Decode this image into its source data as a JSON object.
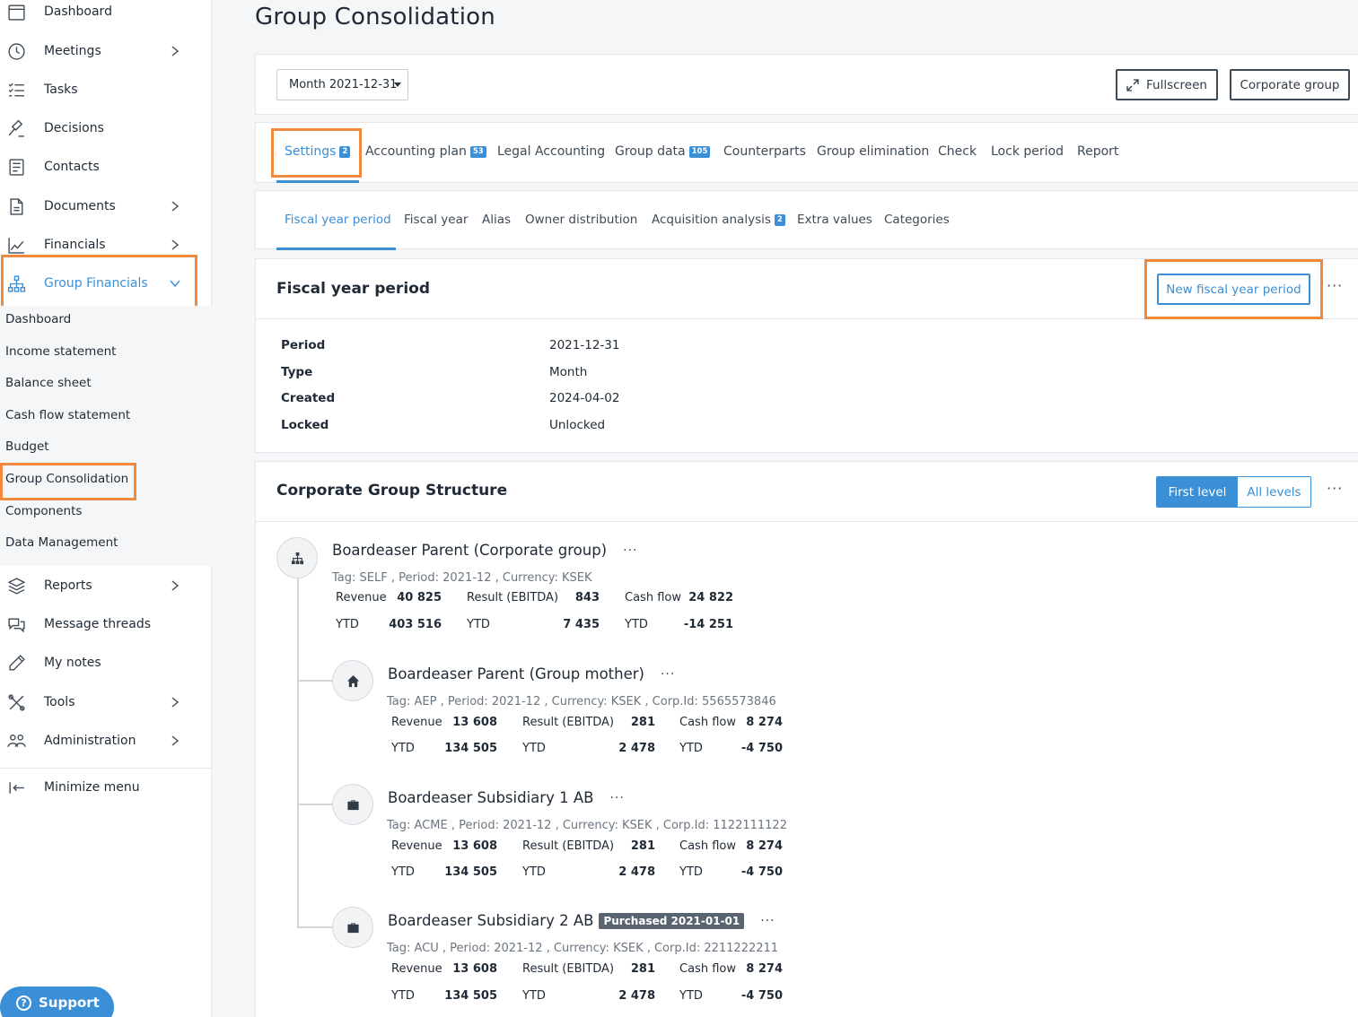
{
  "sidebar": {
    "items": [
      {
        "label": "Dashboard",
        "icon": "calendar-icon"
      },
      {
        "label": "Meetings",
        "icon": "clock-icon"
      },
      {
        "label": "Tasks",
        "icon": "checklist-icon"
      },
      {
        "label": "Decisions",
        "icon": "gavel-icon"
      },
      {
        "label": "Contacts",
        "icon": "contacts-icon"
      },
      {
        "label": "Documents",
        "icon": "document-icon"
      },
      {
        "label": "Financials",
        "icon": "chart-line-icon"
      },
      {
        "label": "Group Financials",
        "icon": "hierarchy-icon"
      },
      {
        "label": "Reports",
        "icon": "layers-icon"
      },
      {
        "label": "Message threads",
        "icon": "chat-icon"
      },
      {
        "label": "My notes",
        "icon": "pencil-icon"
      },
      {
        "label": "Tools",
        "icon": "tools-icon"
      },
      {
        "label": "Administration",
        "icon": "users-icon"
      }
    ],
    "submenu": [
      "Dashboard",
      "Income statement",
      "Balance sheet",
      "Cash flow statement",
      "Budget",
      "Group Consolidation",
      "Components",
      "Data Management"
    ],
    "minimize_label": "Minimize menu",
    "support_label": "Support",
    "accent_color": "#3a8fd6",
    "highlight_color": "#f0883e"
  },
  "page_title": "Group Consolidation",
  "toolbar": {
    "period_value": "Month 2021-12-31",
    "fullscreen_label": "Fullscreen",
    "corporate_group_label": "Corporate group"
  },
  "tabs": [
    {
      "label": "Settings",
      "badge": "2"
    },
    {
      "label": "Accounting plan",
      "badge": "53"
    },
    {
      "label": "Legal Accounting",
      "badge": ""
    },
    {
      "label": "Group data",
      "badge": "105"
    },
    {
      "label": "Counterparts",
      "badge": ""
    },
    {
      "label": "Group elimination",
      "badge": ""
    },
    {
      "label": "Check",
      "badge": ""
    },
    {
      "label": "Lock period",
      "badge": ""
    },
    {
      "label": "Report",
      "badge": ""
    }
  ],
  "subtabs": [
    {
      "label": "Fiscal year period",
      "badge": ""
    },
    {
      "label": "Fiscal year",
      "badge": ""
    },
    {
      "label": "Alias",
      "badge": ""
    },
    {
      "label": "Owner distribution",
      "badge": ""
    },
    {
      "label": "Acquisition analysis",
      "badge": "2"
    },
    {
      "label": "Extra values",
      "badge": ""
    },
    {
      "label": "Categories",
      "badge": ""
    }
  ],
  "fiscal_period": {
    "title": "Fiscal year period",
    "new_button": "New fiscal year period",
    "menu": "···",
    "rows": [
      {
        "key": "Period",
        "value": "2021-12-31"
      },
      {
        "key": "Type",
        "value": "Month"
      },
      {
        "key": "Created",
        "value": "2024-04-02"
      },
      {
        "key": "Locked",
        "value": "Unlocked"
      }
    ]
  },
  "structure": {
    "title": "Corporate Group Structure",
    "first_level_label": "First level",
    "all_levels_label": "All levels",
    "menu": "···",
    "metric_labels": {
      "revenue": "Revenue",
      "result": "Result (EBITDA)",
      "cashflow": "Cash flow",
      "ytd": "YTD"
    },
    "nodes": [
      {
        "name": "Boardeaser Parent (Corporate group)",
        "icon": "org-chart-icon",
        "badge": "",
        "meta": "Tag: SELF , Period: 2021-12 , Currency: KSEK",
        "revenue": "40 825",
        "revenue_ytd": "403 516",
        "result": "843",
        "result_ytd": "7 435",
        "cashflow": "24 822",
        "cashflow_ytd": "-14 251"
      },
      {
        "name": "Boardeaser Parent (Group mother)",
        "icon": "home-icon",
        "badge": "",
        "meta": "Tag: AEP , Period: 2021-12 , Currency: KSEK , Corp.Id: 5565573846",
        "revenue": "13 608",
        "revenue_ytd": "134 505",
        "result": "281",
        "result_ytd": "2 478",
        "cashflow": "8 274",
        "cashflow_ytd": "-4 750"
      },
      {
        "name": "Boardeaser Subsidiary 1 AB",
        "icon": "briefcase-icon",
        "badge": "",
        "meta": "Tag: ACME , Period: 2021-12 , Currency: KSEK , Corp.Id: 1122111122",
        "revenue": "13 608",
        "revenue_ytd": "134 505",
        "result": "281",
        "result_ytd": "2 478",
        "cashflow": "8 274",
        "cashflow_ytd": "-4 750"
      },
      {
        "name": "Boardeaser Subsidiary 2 AB",
        "icon": "briefcase-icon",
        "badge": "Purchased 2021-01-01",
        "meta": "Tag: ACU , Period: 2021-12 , Currency: KSEK , Corp.Id: 2211222211",
        "revenue": "13 608",
        "revenue_ytd": "134 505",
        "result": "281",
        "result_ytd": "2 478",
        "cashflow": "8 274",
        "cashflow_ytd": "-4 750"
      }
    ]
  }
}
